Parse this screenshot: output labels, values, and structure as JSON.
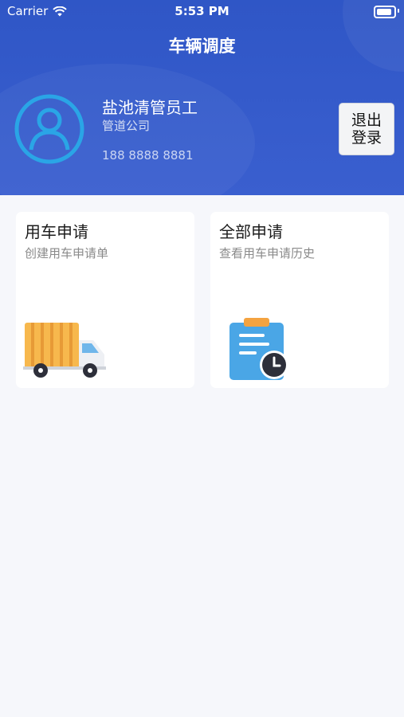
{
  "status_bar": {
    "carrier": "Carrier",
    "time": "5:53 PM"
  },
  "nav": {
    "title": "车辆调度"
  },
  "profile": {
    "name": "盐池清管员工",
    "company": "管道公司",
    "phone": "188 8888 8881",
    "logout_label": "退出登录"
  },
  "cards": [
    {
      "title": "用车申请",
      "subtitle": "创建用车申请单",
      "icon": "truck-icon"
    },
    {
      "title": "全部申请",
      "subtitle": "查看用车申请历史",
      "icon": "clipboard-clock-icon"
    }
  ],
  "colors": {
    "header_bg": "#2f56c6",
    "page_bg": "#f6f7fb",
    "avatar_ring": "#2aa5e6"
  }
}
